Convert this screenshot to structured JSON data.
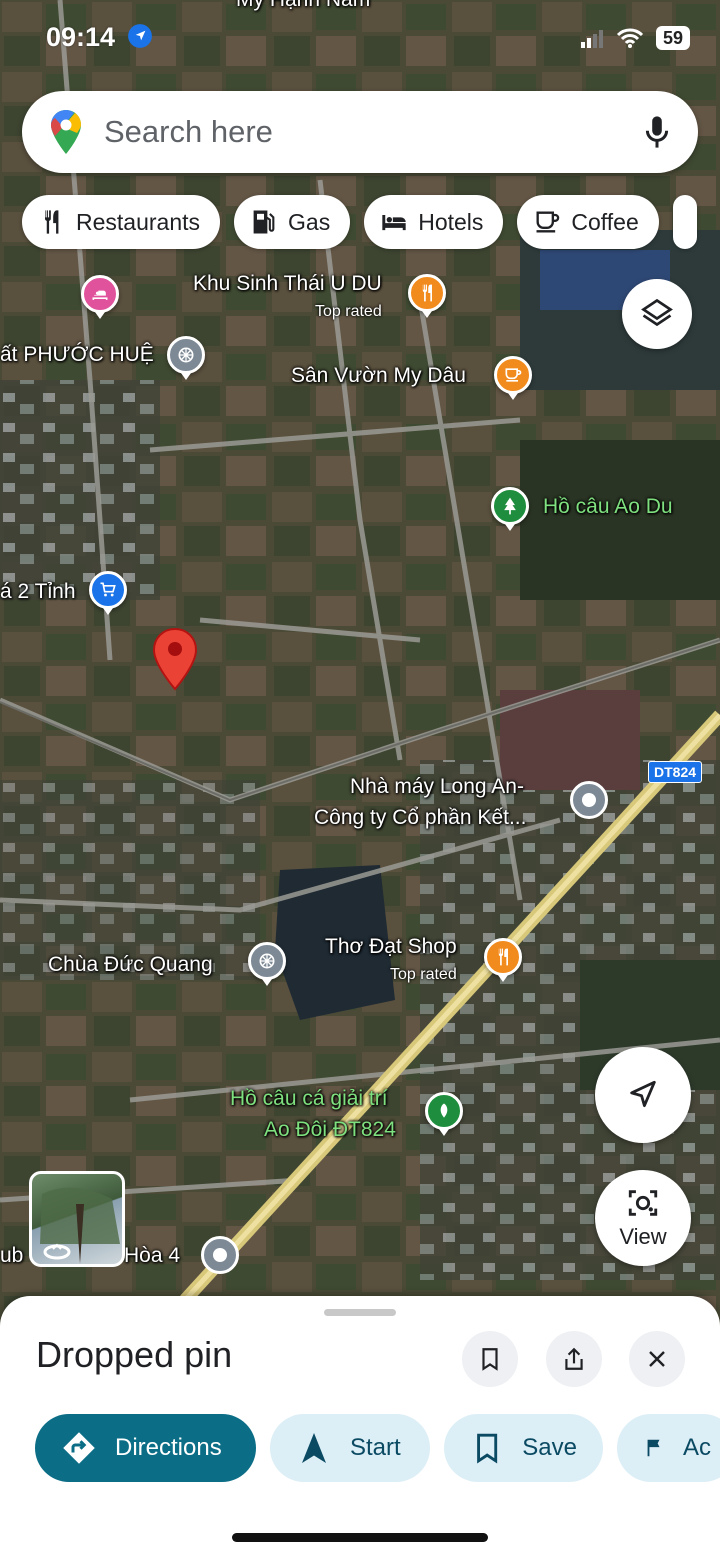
{
  "status": {
    "time": "09:14",
    "battery": "59"
  },
  "search": {
    "placeholder": "Search here"
  },
  "chips": [
    {
      "label": "Restaurants",
      "icon": "restaurant-icon"
    },
    {
      "label": "Gas",
      "icon": "gas-station-icon"
    },
    {
      "label": "Hotels",
      "icon": "hotel-icon"
    },
    {
      "label": "Coffee",
      "icon": "coffee-icon"
    }
  ],
  "map": {
    "labels": {
      "top_cut": "My Hạnh Nam",
      "khu_sinh_thai": "Khu Sinh Thái U DU",
      "khu_sinh_thai_sub": "Top rated",
      "phuoc_hue": "ất PHƯỚC HUỆ",
      "san_vuon": "Sân Vườn My Dâu",
      "ho_cau_ao_du": "Hồ câu Ao Du",
      "hai_tinh": "á 2 Tỉnh",
      "nha_may_1": "Nhà máy Long An-",
      "nha_may_2": "Công ty Cổ phần Kết...",
      "road": "DT824",
      "chua": "Chùa Đức Quang",
      "tho_dat": "Thơ Đạt Shop",
      "tho_dat_sub": "Top rated",
      "ho_cau_giai_tri_1": "Hồ câu cá giải trí",
      "ho_cau_giai_tri_2": "Ao Đôi ĐT824",
      "hoa4": "Hòa 4",
      "club": "ub"
    },
    "colors": {
      "restaurant": "#f28b1e",
      "cafe": "#f28b1e",
      "hotel": "#e0529c",
      "shopping": "#1a73e8",
      "park": "#1e8e3e",
      "religious": "#7d8a96",
      "pin": "#ea4335"
    }
  },
  "buttons": {
    "view": "View"
  },
  "sheet": {
    "title": "Dropped pin",
    "actions": [
      {
        "label": "Directions",
        "icon": "directions-icon"
      },
      {
        "label": "Start",
        "icon": "navigation-arrow-icon"
      },
      {
        "label": "Save",
        "icon": "bookmark-icon"
      },
      {
        "label": "Ac",
        "icon": "flag-icon"
      }
    ]
  }
}
